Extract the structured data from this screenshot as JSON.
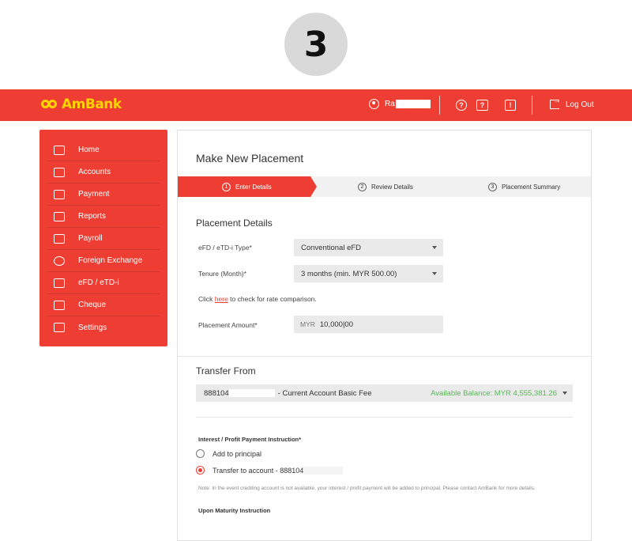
{
  "step_number": "3",
  "header": {
    "brand": "AmBank",
    "user_name": "Ra",
    "logout_label": "Log Out"
  },
  "sidebar": {
    "items": [
      {
        "label": "Home",
        "icon": "home-icon"
      },
      {
        "label": "Accounts",
        "icon": "accounts-icon"
      },
      {
        "label": "Payment",
        "icon": "payment-icon"
      },
      {
        "label": "Reports",
        "icon": "reports-icon"
      },
      {
        "label": "Payroll",
        "icon": "payroll-icon"
      },
      {
        "label": "Foreign Exchange",
        "icon": "euro-icon"
      },
      {
        "label": "eFD / eTD-i",
        "icon": "dollar-icon"
      },
      {
        "label": "Cheque",
        "icon": "cheque-icon"
      },
      {
        "label": "Settings",
        "icon": "tools-icon"
      }
    ]
  },
  "main": {
    "title": "Make New Placement",
    "steps": [
      {
        "num": "1",
        "label": "Enter Details"
      },
      {
        "num": "2",
        "label": "Review Details"
      },
      {
        "num": "3",
        "label": "Placement Summary"
      }
    ],
    "placement": {
      "section_title": "Placement Details",
      "type_label": "eFD / eTD-i Type*",
      "type_value": "Conventional eFD",
      "tenure_label": "Tenure (Month)*",
      "tenure_value": "3 months (min. MYR 500.00)",
      "hint_prefix": "Click ",
      "hint_link": "here",
      "hint_suffix": " to check for rate comparison.",
      "amount_label": "Placement Amount*",
      "amount_currency": "MYR",
      "amount_value": "10,000|00"
    },
    "transfer": {
      "section_title": "Transfer From",
      "account_number": "888104",
      "account_name": "- Current Account Basic Fee",
      "balance": "Available Balance: MYR 4,555,381.26"
    },
    "interest": {
      "label": "Interest / Profit Payment Instruction*",
      "option_principal": "Add to principal",
      "option_transfer": "Transfer to account - 888104",
      "note": "Note: In the event crediting account is not available, your interest / profit payment will be added to principal. Please contact AmBank for more details."
    },
    "maturity_label": "Upon Maturity Instruction"
  }
}
